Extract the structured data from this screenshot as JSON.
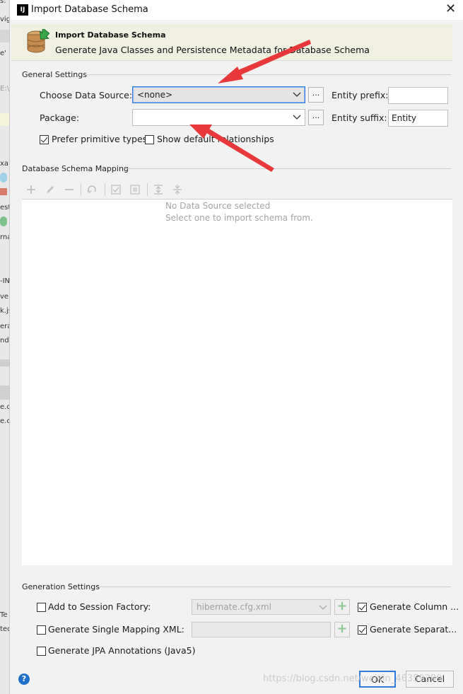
{
  "window": {
    "title": "Import Database Schema",
    "app_icon": "IJ",
    "close": "✕"
  },
  "banner": {
    "title": "Import Database Schema",
    "subtitle": "Generate Java Classes and Persistence Metadata for Database Schema"
  },
  "general_settings": {
    "section_title": "General Settings",
    "data_source_label": "Choose Data Source:",
    "data_source_value": "<none>",
    "browse_button": "...",
    "entity_prefix_label": "Entity prefix:",
    "entity_prefix_value": "",
    "package_label": "Package:",
    "package_value": "",
    "entity_suffix_label": "Entity suffix:",
    "entity_suffix_value": "Entity",
    "prefer_primitive_label": "Prefer primitive types",
    "prefer_primitive_checked": true,
    "show_relationships_label": "Show default relationships",
    "show_relationships_checked": false
  },
  "mapping": {
    "section_title": "Database Schema Mapping",
    "empty_line1": "No Data Source selected",
    "empty_line2": "Select one to import schema from."
  },
  "generation_settings": {
    "section_title": "Generation Settings",
    "session_factory_label": "Add to Session Factory:",
    "session_factory_value": "hibernate.cfg.xml",
    "session_factory_checked": false,
    "single_mapping_label": "Generate Single Mapping XML:",
    "single_mapping_checked": false,
    "jpa_label": "Generate JPA Annotations (Java5)",
    "jpa_checked": false,
    "gen_column_label": "Generate Column ...",
    "gen_column_checked": true,
    "gen_separate_label": "Generate Separat...",
    "gen_separate_checked": true
  },
  "footer": {
    "help": "?",
    "ok": "OK",
    "cancel": "Cancel"
  },
  "background_ide": {
    "fragments": [
      "s:",
      "vig",
      "e'",
      "E:\\",
      "xa",
      "est",
      "rna",
      "-IN",
      "veb",
      "k.js",
      "era",
      "nd",
      "e.c",
      "e.c",
      "Te",
      "ted"
    ]
  },
  "watermark": "https://blog.csdn.net/weixin_46359399",
  "colors": {
    "accent": "#2d7be0",
    "arrow": "#e8383b",
    "banner_bg": "#f0f0e1",
    "help": "#1f70c9"
  }
}
